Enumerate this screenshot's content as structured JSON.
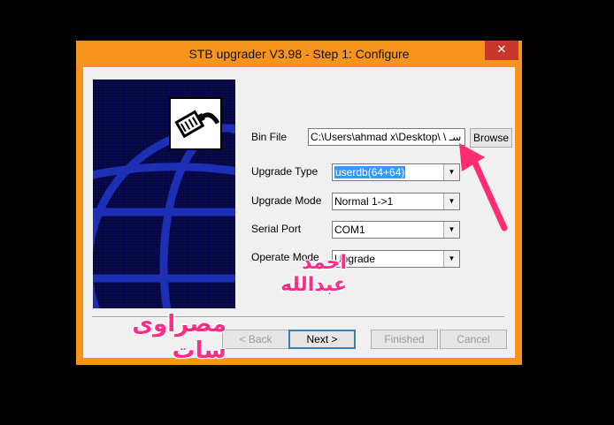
{
  "window": {
    "title": "STB upgrader V3.98 - Step 1: Configure",
    "close_glyph": "✕"
  },
  "form": {
    "bin_file": {
      "label": "Bin File",
      "value": "C:\\Users\\ahmad x\\Desktop\\ \\ سـ",
      "browse_label": "Browse"
    },
    "upgrade_type": {
      "label": "Upgrade Type",
      "value": "userdb(64+64)"
    },
    "upgrade_mode": {
      "label": "Upgrade Mode",
      "value": "Normal 1->1"
    },
    "serial_port": {
      "label": "Serial Port",
      "value": "COM1"
    },
    "operate_mode": {
      "label": "Operate Mode",
      "value": "Upgrade"
    }
  },
  "buttons": {
    "back": "< Back",
    "next": "Next >",
    "finished": "Finished",
    "cancel": "Cancel"
  },
  "overlay": {
    "name_text": "احمد عبدالله",
    "channel_text": "مصراوى سات"
  },
  "colors": {
    "window_frame": "#f7941d",
    "close_button": "#c7382b",
    "arrow": "#ff2d6f",
    "overlay_text": "#ff2d87",
    "sidebar": "#0a0a5a"
  },
  "icons": {
    "arrow_down": "▼",
    "logo": "network-plug-icon"
  }
}
